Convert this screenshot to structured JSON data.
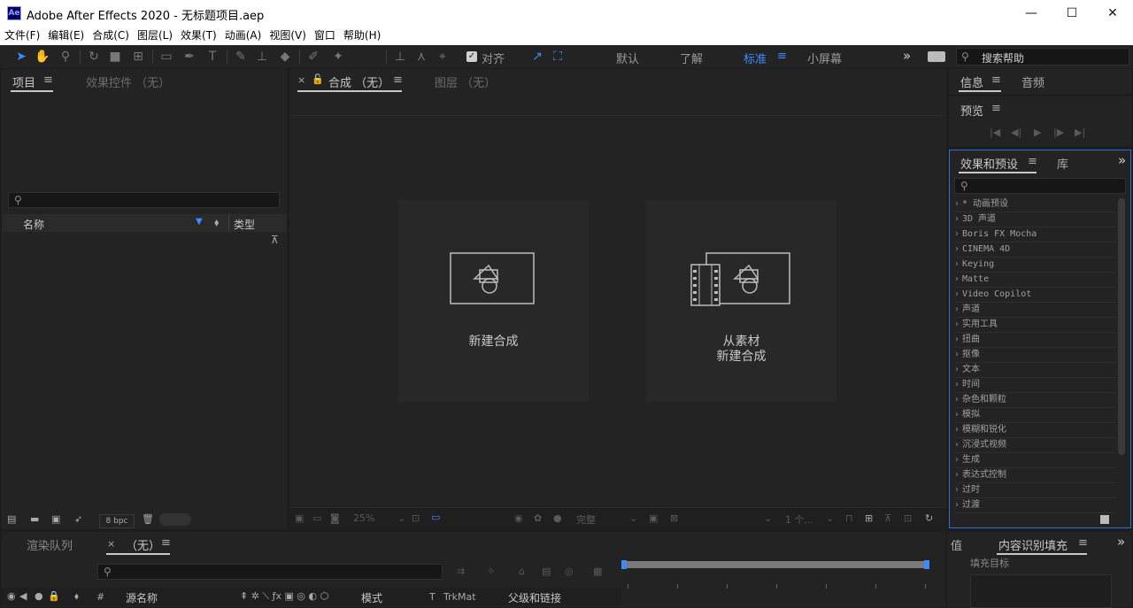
{
  "window": {
    "app_icon_text": "Ae",
    "title": "Adobe After Effects 2020 - 无标题项目.aep",
    "min_glyph": "—",
    "max_glyph": "☐",
    "close_glyph": "✕"
  },
  "menu": [
    "文件(F)",
    "编辑(E)",
    "合成(C)",
    "图层(L)",
    "效果(T)",
    "动画(A)",
    "视图(V)",
    "窗口",
    "帮助(H)"
  ],
  "toolbar": {
    "snap_label": "对齐",
    "workspaces": [
      "默认",
      "了解",
      "标准",
      "小屏幕"
    ],
    "active_workspace": "标准",
    "search_help_placeholder": "搜索帮助",
    "more_glyph": "»"
  },
  "project_panel": {
    "tab_project": "项目",
    "tab_effect_controls": "效果控件 （无）",
    "col_name": "名称",
    "col_type": "类型",
    "bpc": "8 bpc"
  },
  "comp_panel": {
    "tab_close": "×",
    "tab_comp": "合成 （无）",
    "tab_layer": "图层 （无）",
    "card_new_comp": "新建合成",
    "card_from_footage_line1": "从素材",
    "card_from_footage_line2": "新建合成",
    "zoom": "25%",
    "quality": "完整",
    "views": "1 个..."
  },
  "right_panel": {
    "tab_info": "信息",
    "tab_audio": "音频",
    "tab_preview": "预览",
    "tab_effects": "效果和预设",
    "tab_library": "库",
    "effects": [
      "* 动画预设",
      "3D 声道",
      "Boris FX Mocha",
      "CINEMA 4D",
      "Keying",
      "Matte",
      "Video Copilot",
      "声道",
      "实用工具",
      "扭曲",
      "抠像",
      "文本",
      "时间",
      "杂色和颗粒",
      "模拟",
      "模糊和锐化",
      "沉浸式视频",
      "生成",
      "表达式控制",
      "过时",
      "过渡"
    ]
  },
  "timeline": {
    "tab_render_queue": "渲染队列",
    "tab_close": "×",
    "tab_comp": "（无）",
    "col_hash": "#",
    "col_source_name": "源名称",
    "col_mode": "模式",
    "col_t": "T",
    "col_trkmat": "TrkMat",
    "col_parent": "父级和链接"
  },
  "bottom_right": {
    "tab_value": "值",
    "tab_content_aware_fill": "内容识别填充",
    "fill_target_label": "填充目标"
  },
  "colors": {
    "accent": "#3d8bff",
    "panel_bg": "#232323",
    "app_bg": "#1d1d1d"
  }
}
